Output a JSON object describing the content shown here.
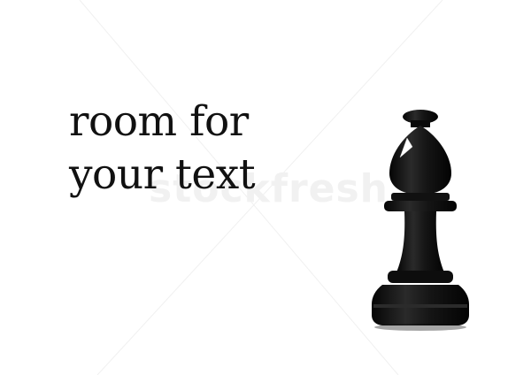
{
  "caption": {
    "line1": "room for",
    "line2": "your text"
  },
  "watermark": {
    "text": "stockfresh"
  },
  "colors": {
    "background": "#ffffff",
    "text": "#111111",
    "piece": "#141414",
    "watermark": "#f1f1f1"
  },
  "figure": {
    "piece": "chess-bishop-black"
  }
}
